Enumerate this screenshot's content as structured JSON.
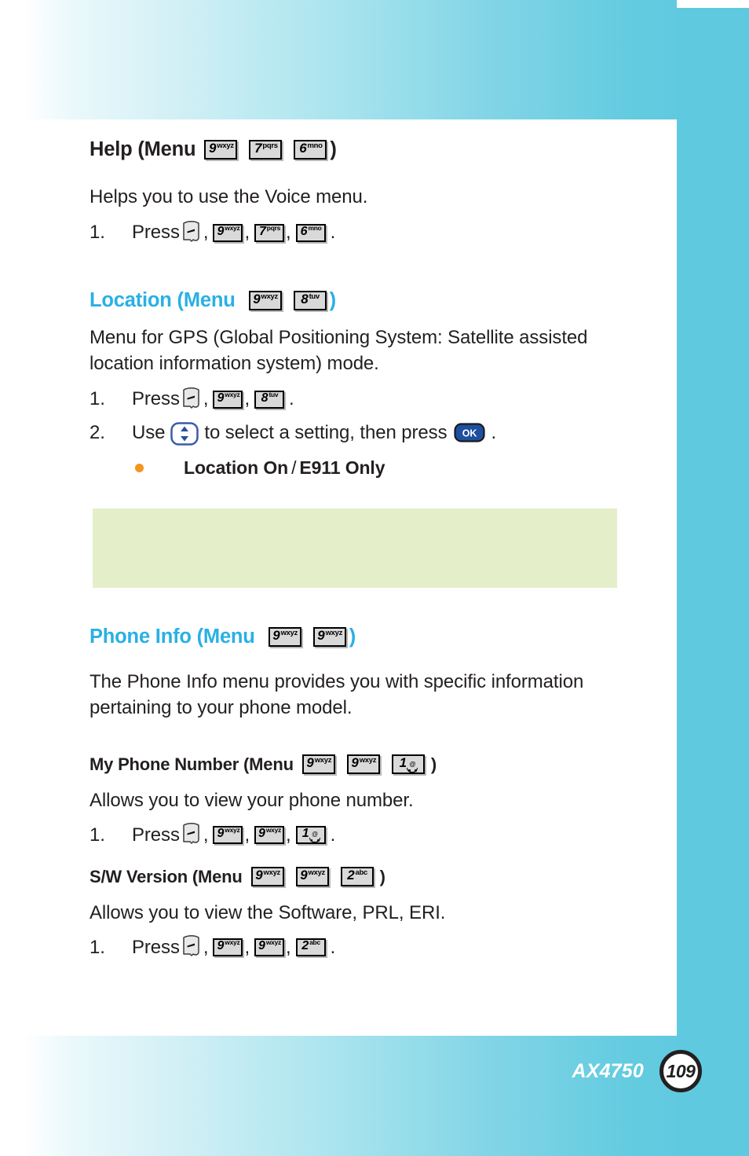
{
  "document": {
    "model_name": "AX4750",
    "page_number": "109"
  },
  "colors": {
    "heading_cyan": "#29b0e5",
    "heading_black": "#231f20",
    "bullet_orange": "#f7941e",
    "note_box_green": "#e4efca",
    "band_cyan": "#5fc9df",
    "ok_key_blue": "#1e4fa0"
  },
  "sections": [
    {
      "id": "help",
      "heading": {
        "title": "Help (Menu",
        "close_paren": ")",
        "style": "black",
        "keys": [
          {
            "digit": "9",
            "letters": "wxyz"
          },
          {
            "digit": "7",
            "letters": "pqrs"
          },
          {
            "digit": "6",
            "letters": "mno"
          }
        ]
      },
      "body": "Helps you to use the Voice menu.",
      "steps": [
        {
          "number": "1.",
          "prefix": "Press",
          "send_key": "send-key",
          "keys": [
            {
              "digit": "9",
              "letters": "wxyz"
            },
            {
              "digit": "7",
              "letters": "pqrs"
            },
            {
              "digit": "6",
              "letters": "mno"
            }
          ],
          "suffix": "."
        }
      ]
    },
    {
      "id": "location",
      "heading": {
        "title": "Location (Menu",
        "close_paren": ")",
        "style": "cyan",
        "keys": [
          {
            "digit": "9",
            "letters": "wxyz"
          },
          {
            "digit": "8",
            "letters": "tuv"
          }
        ]
      },
      "body": "Menu for GPS (Global Positioning System: Satellite assisted location information system) mode.",
      "steps": [
        {
          "number": "1.",
          "prefix": "Press",
          "send_key": "send-key",
          "keys": [
            {
              "digit": "9",
              "letters": "wxyz"
            },
            {
              "digit": "8",
              "letters": "tuv"
            }
          ],
          "suffix": "."
        },
        {
          "number": "2.",
          "prefix": "Use",
          "nav_key": "nav-up-down-key",
          "middle": "to select a setting, then press",
          "ok_key": "OK",
          "suffix": "."
        }
      ],
      "bullets": [
        {
          "strong_a": "Location On",
          "separator": "/",
          "strong_b": "E911 Only"
        }
      ],
      "note_box": {
        "text": ""
      }
    },
    {
      "id": "phone-info",
      "heading": {
        "title": "Phone Info (Menu",
        "close_paren": ")",
        "style": "cyan",
        "keys": [
          {
            "digit": "9",
            "letters": "wxyz"
          },
          {
            "digit": "9",
            "letters": "wxyz"
          }
        ]
      },
      "body": "The Phone Info menu provides you with specific information pertaining to your phone model."
    },
    {
      "id": "my-phone-number",
      "heading": {
        "title": "My Phone Number (Menu",
        "close_paren": ")",
        "style": "black",
        "size": "small",
        "keys": [
          {
            "digit": "9",
            "letters": "wxyz"
          },
          {
            "digit": "9",
            "letters": "wxyz"
          },
          {
            "digit": "1",
            "letters": "",
            "glyph": "voicemail-at-icon"
          }
        ]
      },
      "body": "Allows you to view your phone number.",
      "steps": [
        {
          "number": "1.",
          "prefix": "Press",
          "send_key": "send-key",
          "keys": [
            {
              "digit": "9",
              "letters": "wxyz"
            },
            {
              "digit": "9",
              "letters": "wxyz"
            },
            {
              "digit": "1",
              "letters": "",
              "glyph": "voicemail-at-icon"
            }
          ],
          "suffix": "."
        }
      ]
    },
    {
      "id": "sw-version",
      "heading": {
        "title": "S/W Version (Menu",
        "close_paren": ")",
        "style": "black",
        "size": "small",
        "keys": [
          {
            "digit": "9",
            "letters": "wxyz"
          },
          {
            "digit": "9",
            "letters": "wxyz"
          },
          {
            "digit": "2",
            "letters": "abc"
          }
        ]
      },
      "body": "Allows you to view the Software, PRL, ERI.",
      "steps": [
        {
          "number": "1.",
          "prefix": "Press",
          "send_key": "send-key",
          "keys": [
            {
              "digit": "9",
              "letters": "wxyz"
            },
            {
              "digit": "9",
              "letters": "wxyz"
            },
            {
              "digit": "2",
              "letters": "abc"
            }
          ],
          "suffix": "."
        }
      ]
    }
  ]
}
